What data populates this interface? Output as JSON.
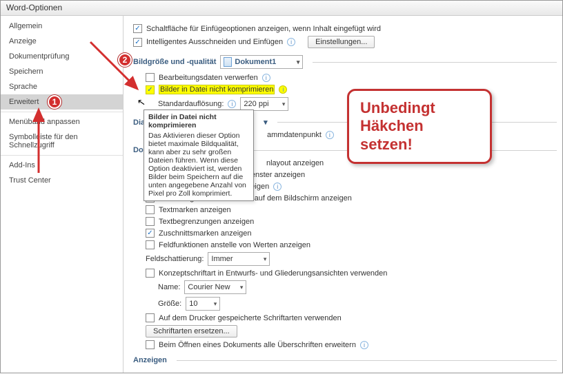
{
  "window": {
    "title": "Word-Optionen"
  },
  "sidebar": {
    "items": [
      {
        "label": "Allgemein"
      },
      {
        "label": "Anzeige"
      },
      {
        "label": "Dokumentprüfung"
      },
      {
        "label": "Speichern"
      },
      {
        "label": "Sprache"
      },
      {
        "label": "Erweitert"
      },
      {
        "label": "Menüband anpassen"
      },
      {
        "label": "Symbolleiste für den Schnellzugriff"
      },
      {
        "label": "Add-Ins"
      },
      {
        "label": "Trust Center"
      }
    ]
  },
  "top": {
    "paste_options": "Schaltfläche für Einfügeoptionen anzeigen, wenn Inhalt eingefügt wird",
    "smart_cut_paste": "Intelligentes Ausschneiden und Einfügen",
    "settings_btn": "Einstellungen..."
  },
  "sections": {
    "image": {
      "title": "Bildgröße und -qualität",
      "doc_value": "Dokument1",
      "discard_edit": "Bearbeitungsdaten verwerfen",
      "no_compress": "Bilder in Datei nicht komprimieren",
      "default_res_label": "Standardauflösung:",
      "default_res_value": "220 ppi"
    },
    "chart": {
      "title_prefix": "Dia",
      "datapoint": "ammdatenpunkt"
    },
    "doc": {
      "title_prefix": "Do",
      "items": [
        "nlayout anzeigen",
        "Textumbruch im Dokumentfenster anzeigen",
        "Platzhalter für Grafiken anzeigen",
        "Zeichnungen und Textfelder auf dem Bildschirm anzeigen",
        "Textmarken anzeigen",
        "Textbegrenzungen anzeigen",
        "Zuschnittsmarken anzeigen",
        "Feldfunktionen anstelle von Werten anzeigen"
      ],
      "shading_label": "Feldschattierung:",
      "shading_value": "Immer",
      "concept_font": "Konzeptschriftart in Entwurfs- und Gliederungsansichten verwenden",
      "name_label": "Name:",
      "name_value": "Courier New",
      "size_label": "Größe:",
      "size_value": "10",
      "printer_fonts": "Auf dem Drucker gespeicherte Schriftarten verwenden",
      "replace_fonts_btn": "Schriftarten ersetzen...",
      "expand_headings": "Beim Öffnen eines Dokuments alle Überschriften erweitern"
    },
    "display": {
      "title": "Anzeigen"
    }
  },
  "tooltip": {
    "title": "Bilder in Datei nicht komprimieren",
    "body": "Das Aktivieren dieser Option bietet maximale Bildqualität, kann aber zu sehr großen Dateien führen. Wenn diese Option deaktiviert ist, werden Bilder beim Speichern auf die unten angegebene Anzahl von Pixel pro Zoll komprimiert."
  },
  "annotations": {
    "badge1": "1",
    "badge2": "2",
    "callout_line1": "Unbedingt",
    "callout_line2": "Häkchen setzen!"
  }
}
